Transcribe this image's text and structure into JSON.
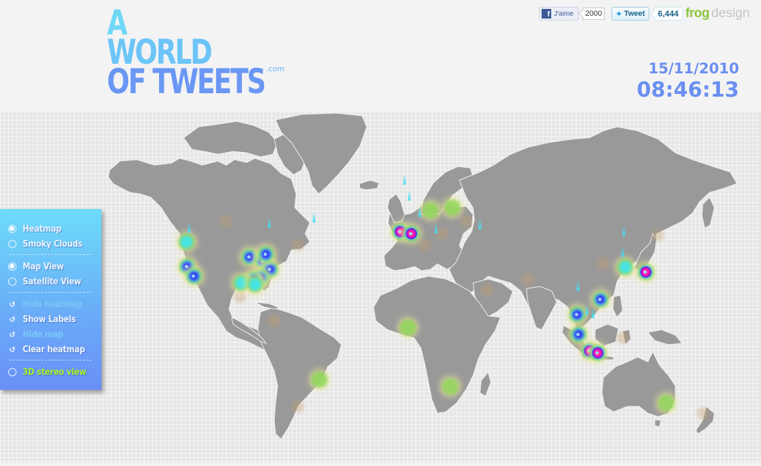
{
  "header": {
    "logo": {
      "line1": "A",
      "line2": "WORLD",
      "line3": "OF TWEETS",
      "suffix": ".com"
    },
    "date": "15/11/2010",
    "time": "08:46:13"
  },
  "social": {
    "facebook": {
      "label": "J'aime",
      "count": "2000",
      "icon": "facebook-f-icon"
    },
    "twitter": {
      "label": "Tweet",
      "count": "6,444",
      "icon": "twitter-bird-icon"
    },
    "brand": {
      "part1": "frog",
      "part2": "design"
    }
  },
  "panel": {
    "groups": [
      {
        "type": "radio",
        "items": [
          {
            "label": "Heatmap",
            "selected": true
          },
          {
            "label": "Smoky Clouds",
            "selected": false
          }
        ]
      },
      {
        "type": "radio",
        "items": [
          {
            "label": "Map View",
            "selected": true
          },
          {
            "label": "Satellite View",
            "selected": false
          }
        ]
      },
      {
        "type": "toggle",
        "items": [
          {
            "label": "Hide heatmap",
            "enabled": false
          },
          {
            "label": "Show Labels",
            "enabled": true
          },
          {
            "label": "Hide map",
            "enabled": false
          },
          {
            "label": "Clear heatmap",
            "enabled": true
          }
        ]
      },
      {
        "type": "radio",
        "items": [
          {
            "label": "3D stereo view",
            "selected": false
          }
        ]
      }
    ]
  },
  "map": {
    "land_color": "#999999",
    "ocean_color": "#e6e6e6",
    "heatmap_colors": {
      "low": "#8fd65a",
      "mid": "#3ee6f0",
      "high": "#3a2cf2",
      "peak": "#ff1aa8"
    },
    "hotspots": [
      {
        "region": "Pacific Northwest",
        "intensity": "medium"
      },
      {
        "region": "California",
        "intensity": "high"
      },
      {
        "region": "Great Lakes / US East",
        "intensity": "high"
      },
      {
        "region": "Texas / Florida",
        "intensity": "medium"
      },
      {
        "region": "UK / Netherlands",
        "intensity": "peak"
      },
      {
        "region": "Scandinavia",
        "intensity": "low"
      },
      {
        "region": "Korea",
        "intensity": "medium"
      },
      {
        "region": "Japan",
        "intensity": "peak"
      },
      {
        "region": "Southeast Asia",
        "intensity": "high"
      },
      {
        "region": "Jakarta",
        "intensity": "peak"
      },
      {
        "region": "West Africa",
        "intensity": "low"
      },
      {
        "region": "South Africa",
        "intensity": "low"
      },
      {
        "region": "Brazil",
        "intensity": "low"
      },
      {
        "region": "Sydney",
        "intensity": "low"
      }
    ]
  }
}
